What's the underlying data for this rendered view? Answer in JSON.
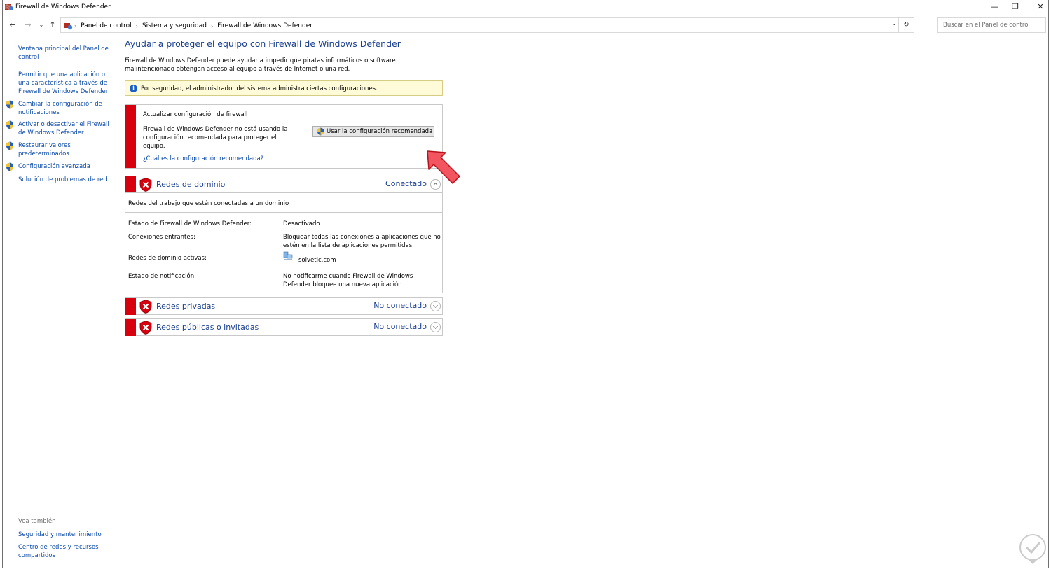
{
  "window": {
    "title": "Firewall de Windows Defender",
    "controls": {
      "minimize": "—",
      "restore": "❐",
      "close": "✕"
    }
  },
  "navbar": {
    "breadcrumbs": [
      "Panel de control",
      "Sistema y seguridad",
      "Firewall de Windows Defender"
    ],
    "search_placeholder": "Buscar en el Panel de control"
  },
  "sidebar": {
    "links": [
      {
        "label": "Ventana principal del Panel de control",
        "shield": false
      },
      {
        "label": "Permitir que una aplicación o una característica a través de Firewall de Windows Defender",
        "shield": false
      },
      {
        "label": "Cambiar la configuración de notificaciones",
        "shield": true
      },
      {
        "label": "Activar o desactivar el Firewall de Windows Defender",
        "shield": true
      },
      {
        "label": "Restaurar valores predeterminados",
        "shield": true
      },
      {
        "label": "Configuración avanzada",
        "shield": true
      },
      {
        "label": "Solución de problemas de red",
        "shield": false
      }
    ],
    "see_also": {
      "heading": "Vea también",
      "links": [
        "Seguridad y mantenimiento",
        "Centro de redes y recursos compartidos"
      ]
    }
  },
  "main": {
    "title": "Ayudar a proteger el equipo con Firewall de Windows Defender",
    "intro": "Firewall de Windows Defender puede ayudar a impedir que piratas informáticos o software malintencionado obtengan acceso al equipo a través de Internet o una red.",
    "info_bar": "Por seguridad, el administrador del sistema administra ciertas configuraciones.",
    "warning": {
      "title": "Actualizar configuración de firewall",
      "body": "Firewall de Windows Defender no está usando la configuración recomendada para proteger el equipo.",
      "button": "Usar la configuración recomendada",
      "link": "¿Cuál es la configuración recomendada?"
    },
    "networks": [
      {
        "name": "Redes de dominio",
        "status": "Conectado",
        "expanded": true,
        "description": "Redes del trabajo que estén conectadas a un dominio",
        "details": [
          {
            "key": "Estado de Firewall de Windows Defender:",
            "value": "Desactivado"
          },
          {
            "key": "Conexiones entrantes:",
            "value": "Bloquear todas las conexiones a aplicaciones que no estén en la lista de aplicaciones permitidas"
          },
          {
            "key": "Redes de dominio activas:",
            "value": "solvetic.com"
          },
          {
            "key": "Estado de notificación:",
            "value": "No notificarme cuando Firewall de Windows Defender bloquee una nueva aplicación"
          }
        ]
      },
      {
        "name": "Redes privadas",
        "status": "No conectado",
        "expanded": false
      },
      {
        "name": "Redes públicas o invitadas",
        "status": "No conectado",
        "expanded": false
      }
    ]
  },
  "colors": {
    "link": "#0c4aa8",
    "heading": "#1a3f8f",
    "alert_red": "#d6000f",
    "info_bg": "#fffbd8"
  }
}
